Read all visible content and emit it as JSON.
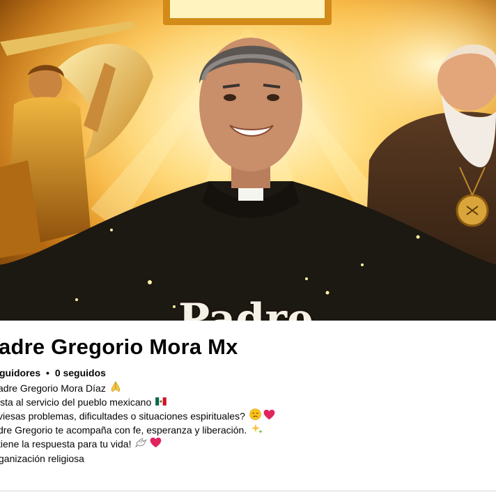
{
  "profile": {
    "name": "adre Gregorio Mora Mx",
    "stats": {
      "followers": "guidores",
      "separator": "•",
      "following": "0 seguidos"
    },
    "bio": [
      "adre Gregorio Mora Díaz",
      "ista al servicio del pueblo mexicano",
      "viesas problemas, dificultades o situaciones espirituales?",
      "dre Gregorio te acompaña con fe, esperanza y liberación.",
      "tiene la respuesta para tu vida!"
    ],
    "category": "ganización religiosa"
  },
  "cover": {
    "banner_text": "Padre",
    "icons": [
      "praying-hands-icon",
      "mexico-flag-icon",
      "sad-face-icon",
      "red-heart-icon",
      "sparkle-icon",
      "dove-icon",
      "red-heart-icon"
    ]
  },
  "colors": {
    "text": "#050505",
    "heart": "#e0245e",
    "divider": "#d6d9dd"
  }
}
